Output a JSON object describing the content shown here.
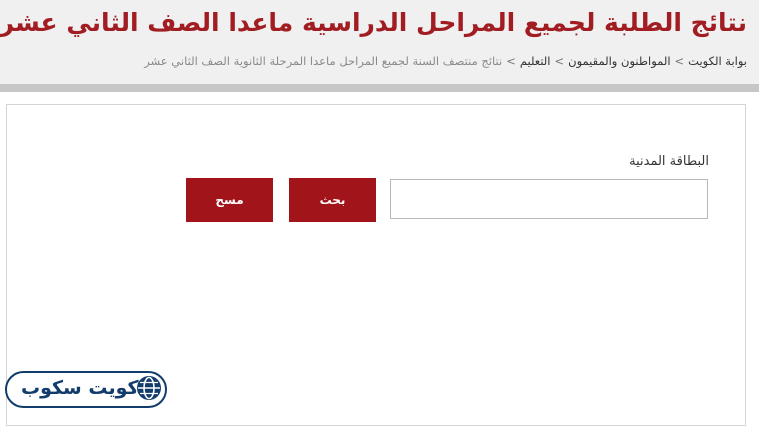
{
  "header": {
    "title": "نتائج الطلبة لجميع المراحل الدراسية ماعدا الصف الثاني عشر",
    "breadcrumb": [
      "بوابة الكويت",
      "المواطنون والمقيمون",
      "التعليم",
      "نتائج منتصف السنة لجميع المراحل ماعدا المرحلة الثانوية الصف الثاني عشر"
    ],
    "breadcrumb_separator": ">"
  },
  "form": {
    "civil_id_label": "البطاقة المدنية",
    "civil_id_value": "",
    "search_button": "بحث",
    "clear_button": "مسح"
  },
  "watermark": {
    "text": "كويت سكوب",
    "icon": "globe-icon"
  },
  "colors": {
    "accent": "#a0141a",
    "title": "#a11d22",
    "logo": "#123c6c"
  }
}
